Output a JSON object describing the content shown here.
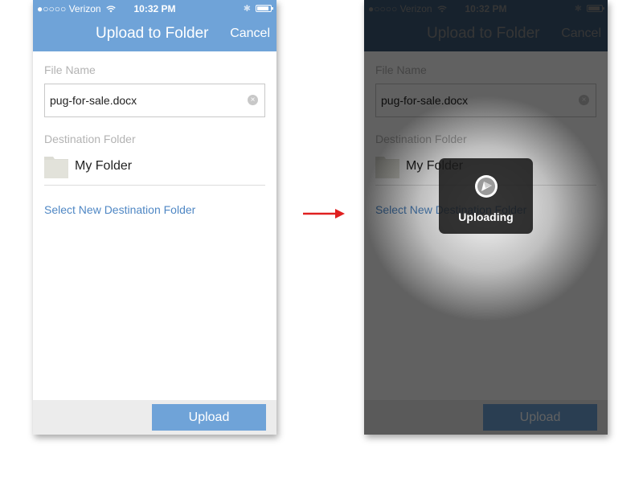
{
  "status": {
    "carrier": "●○○○○ Verizon",
    "time": "10:32 PM"
  },
  "nav": {
    "title": "Upload to Folder",
    "cancel_label": "Cancel"
  },
  "form": {
    "file_name_label": "File Name",
    "file_name_value": "pug-for-sale.docx",
    "destination_label": "Destination Folder",
    "folder_name": "My Folder",
    "select_new_link": "Select New Destination Folder"
  },
  "footer": {
    "upload_label": "Upload"
  },
  "overlay": {
    "hud_text": "Uploading"
  },
  "colors": {
    "accent": "#6fa3d8",
    "link": "#4f87c4",
    "arrow": "#e02020"
  },
  "icons": [
    "wifi-icon",
    "bluetooth-icon",
    "battery-icon",
    "clear-icon",
    "folder-icon",
    "upload-spinner-icon",
    "arrow-right-icon"
  ]
}
